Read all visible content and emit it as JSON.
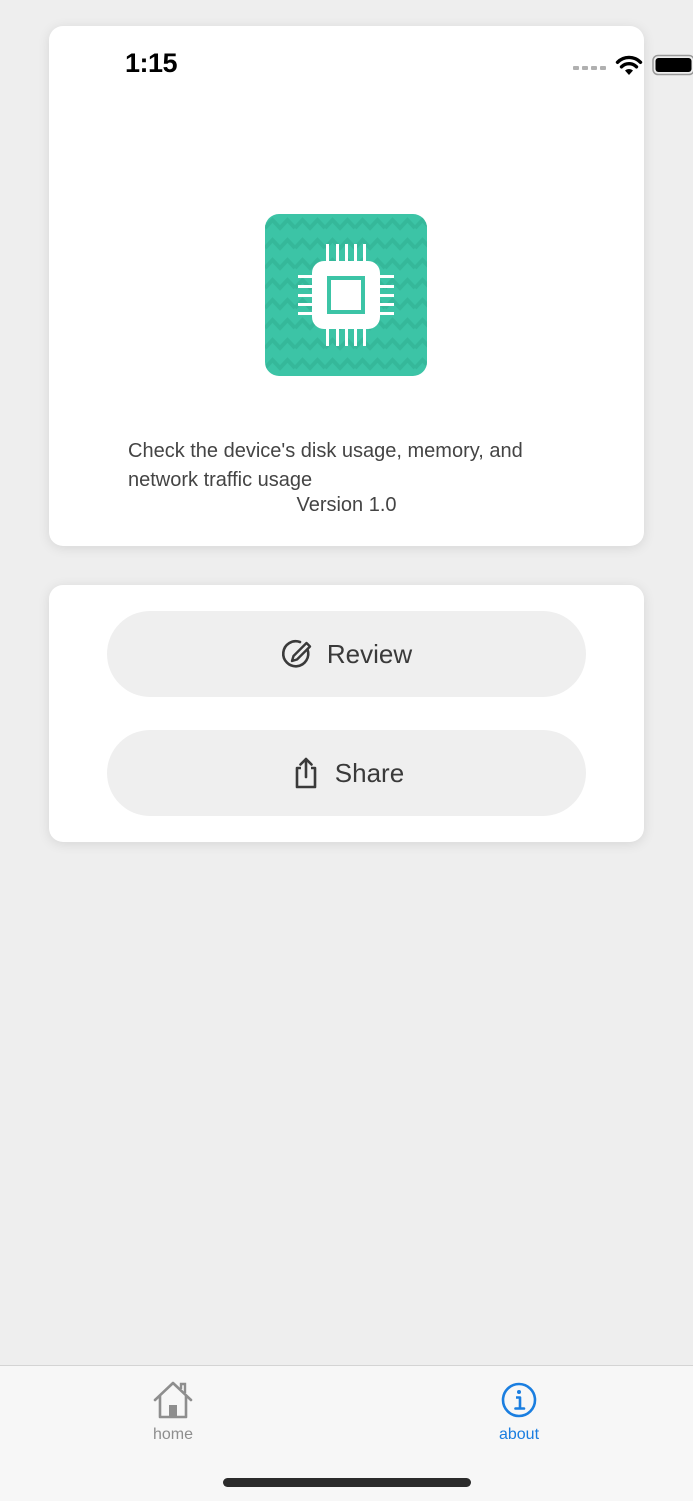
{
  "status_bar": {
    "time": "1:15"
  },
  "about_card": {
    "app_icon": "cpu-chip-icon",
    "description": "Check the device's disk usage, memory, and network traffic usage",
    "version": "Version 1.0"
  },
  "actions": {
    "review": {
      "label": "Review",
      "icon": "review-pencil-icon"
    },
    "share": {
      "label": "Share",
      "icon": "share-icon"
    }
  },
  "tab_bar": {
    "tabs": [
      {
        "label": "home",
        "icon": "house-icon",
        "selected": false
      },
      {
        "label": "about",
        "icon": "info-circle-icon",
        "selected": true
      }
    ]
  },
  "colors": {
    "accent": "#1a7ee0",
    "app_icon_bg": "#3cc4a6",
    "background": "#eeeeee",
    "button_bg": "#efefef"
  }
}
